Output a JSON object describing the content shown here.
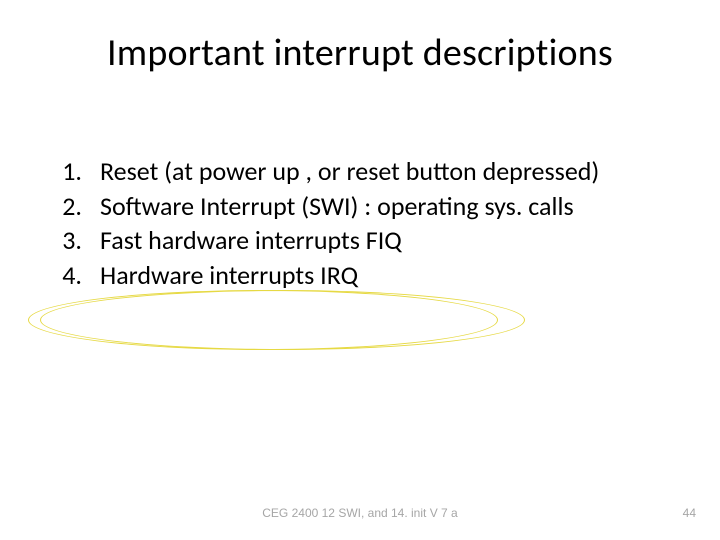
{
  "title": "Important interrupt descriptions",
  "items": [
    {
      "num": "1.",
      "text": "Reset (at power up , or reset button depressed)"
    },
    {
      "num": "2.",
      "text": "Software Interrupt (SWI) : operating sys. calls"
    },
    {
      "num": "3.",
      "text": "Fast hardware interrupts FIQ"
    },
    {
      "num": "4.",
      "text": "Hardware interrupts IRQ"
    }
  ],
  "footer": {
    "center": "CEG 2400 12 SWI, and 14. init V 7 a",
    "page": "44"
  }
}
